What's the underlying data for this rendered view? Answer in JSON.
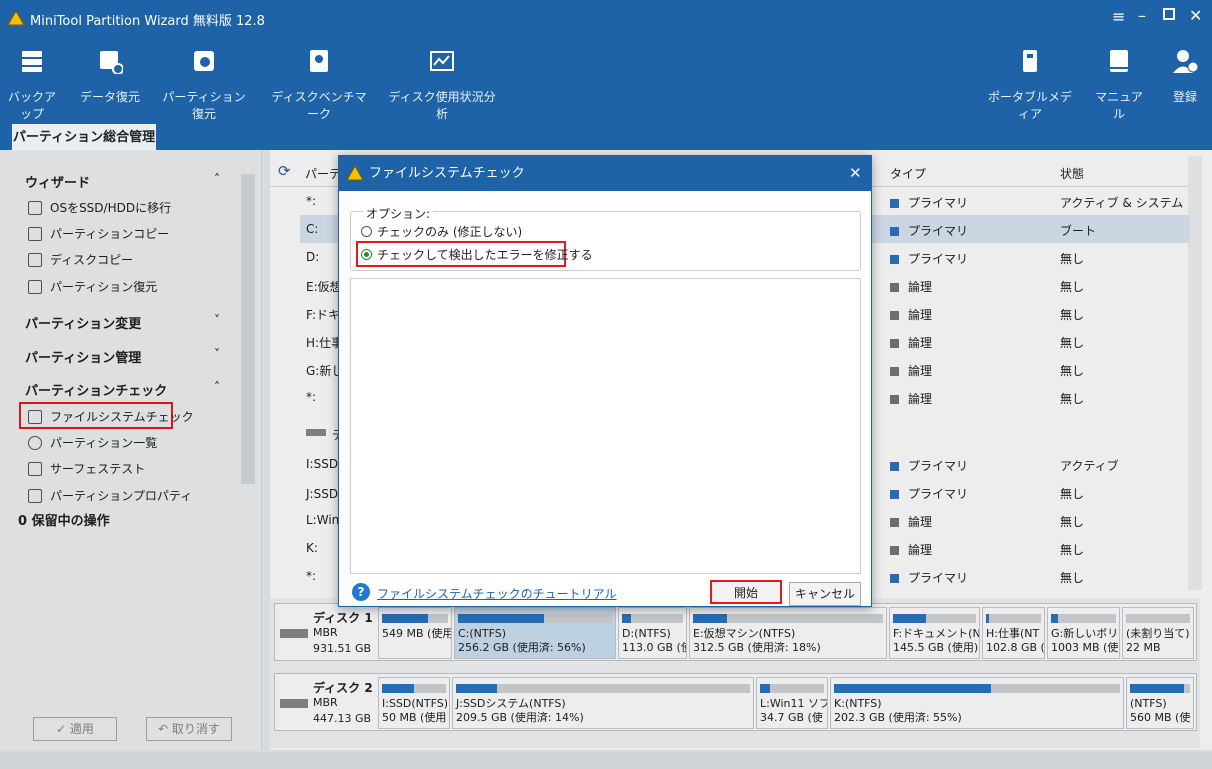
{
  "app": {
    "title": "MiniTool Partition Wizard 無料版 12.8"
  },
  "toolbar": {
    "left": [
      "バックアップ",
      "データ復元",
      "パーティション復元",
      "ディスクベンチマーク",
      "ディスク使用状況分析"
    ],
    "right": [
      "ポータブルメディア",
      "マニュアル",
      "登録"
    ]
  },
  "tab": "パーティション総合管理",
  "sidebar": {
    "wizard": "ウィザード",
    "wizard_items": [
      "OSをSSD/HDDに移行",
      "パーティションコピー",
      "ディスクコピー",
      "パーティション復元"
    ],
    "change": "パーティション変更",
    "manage": "パーティション管理",
    "check": "パーティションチェック",
    "check_items": [
      "ファイルシステムチェック",
      "パーティション一覧",
      "サーフェステスト",
      "パーティションプロパティ"
    ],
    "pending": "0 保留中の操作",
    "apply": "✓ 適用",
    "undo": "↶ 取り消す"
  },
  "table": {
    "col_partition": "パーテ",
    "col_type": "タイプ",
    "col_status": "状態",
    "rows": [
      {
        "name": "*:",
        "type": "プライマリ",
        "status": "アクティブ & システム"
      },
      {
        "name": "C:",
        "type": "プライマリ",
        "status": "ブート"
      },
      {
        "name": "D:",
        "type": "プライマリ",
        "status": "無し"
      },
      {
        "name": "E:仮想",
        "type": "論理",
        "status": "無し"
      },
      {
        "name": "F:ドキュ",
        "type": "論理",
        "status": "無し"
      },
      {
        "name": "H:仕事",
        "type": "論理",
        "status": "無し"
      },
      {
        "name": "G:新しい",
        "type": "論理",
        "status": "無し"
      },
      {
        "name": "*:",
        "type": "論理",
        "status": "無し"
      },
      {
        "name": "I:SSD",
        "type": "プライマリ",
        "status": "アクティブ"
      },
      {
        "name": "J:SSDシ",
        "type": "プライマリ",
        "status": "無し"
      },
      {
        "name": "L:Win1",
        "type": "論理",
        "status": "無し"
      },
      {
        "name": "K:",
        "type": "論理",
        "status": "無し"
      },
      {
        "name": "*:",
        "type": "プライマリ",
        "status": "無し"
      }
    ],
    "disk2_label": "デ"
  },
  "disk1": {
    "name": "ディスク 1",
    "scheme": "MBR",
    "size": "931.51 GB",
    "parts": [
      {
        "l1": "",
        "l2": "549 MB (使用",
        "u": 0.7
      },
      {
        "l1": "C:(NTFS)",
        "l2": "256.2 GB (使用済: 56%)",
        "u": 0.56
      },
      {
        "l1": "D:(NTFS)",
        "l2": "113.0 GB (使",
        "u": 0.15
      },
      {
        "l1": "E:仮想マシン(NTFS)",
        "l2": "312.5 GB (使用済: 18%)",
        "u": 0.18
      },
      {
        "l1": "F:ドキュメント(NT",
        "l2": "145.5 GB (使用)",
        "u": 0.4
      },
      {
        "l1": "H:仕事(NT",
        "l2": "102.8 GB (",
        "u": 0.05
      },
      {
        "l1": "G:新しいボリュ",
        "l2": "1003 MB (使",
        "u": 0.1
      },
      {
        "l1": "(未割り当て)",
        "l2": "22 MB",
        "u": 0
      }
    ]
  },
  "disk2": {
    "name": "ディスク 2",
    "scheme": "MBR",
    "size": "447.13 GB",
    "parts": [
      {
        "l1": "I:SSD(NTFS)",
        "l2": "50 MB (使用",
        "u": 0.5
      },
      {
        "l1": "J:SSDシステム(NTFS)",
        "l2": "209.5 GB (使用済: 14%)",
        "u": 0.14
      },
      {
        "l1": "L:Win11 ソフ",
        "l2": "34.7 GB (使",
        "u": 0.15
      },
      {
        "l1": "K:(NTFS)",
        "l2": "202.3 GB (使用済: 55%)",
        "u": 0.55
      },
      {
        "l1": "(NTFS)",
        "l2": "560 MB (使",
        "u": 0.9
      }
    ]
  },
  "dialog": {
    "title": "ファイルシステムチェック",
    "options_label": "オプション:",
    "opt1": "チェックのみ (修正しない)",
    "opt2": "チェックして検出したエラーを修正する",
    "tutorial": "ファイルシステムチェックのチュートリアル",
    "start": "開始",
    "cancel": "キャンセル"
  }
}
